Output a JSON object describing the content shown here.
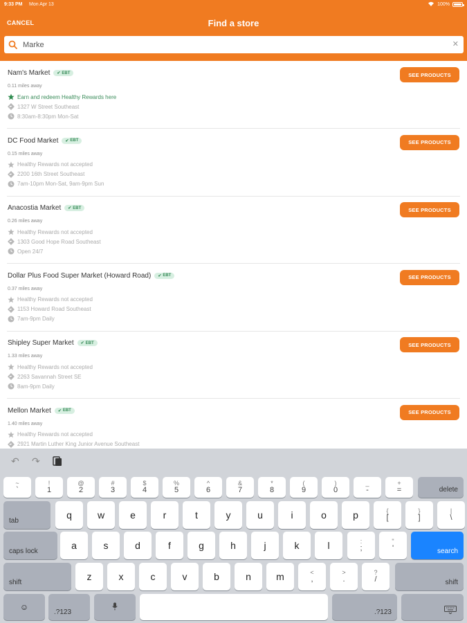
{
  "status": {
    "time": "9:33 PM",
    "date": "Mon Apr 13",
    "battery": "100%"
  },
  "header": {
    "cancel_label": "CANCEL",
    "title": "Find a store"
  },
  "search": {
    "value": "Marke",
    "placeholder": ""
  },
  "see_products_label": "SEE PRODUCTS",
  "ebt_label": "EBT",
  "stores": [
    {
      "name": "Nam's Market",
      "distance": "0.11 miles away",
      "rewards": "Earn and redeem Healthy Rewards here",
      "rewards_accepted": true,
      "address": "1327 W Street Southeast",
      "hours": "8:30am-8:30pm Mon-Sat"
    },
    {
      "name": "DC Food Market",
      "distance": "0.15 miles away",
      "rewards": "Healthy Rewards not accepted",
      "rewards_accepted": false,
      "address": "2200 16th Street Southeast",
      "hours": "7am-10pm Mon-Sat, 9am-9pm Sun"
    },
    {
      "name": "Anacostia Market",
      "distance": "0.26 miles away",
      "rewards": "Healthy Rewards not accepted",
      "rewards_accepted": false,
      "address": "1303 Good Hope Road Southeast",
      "hours": "Open 24/7"
    },
    {
      "name": "Dollar Plus Food Super Market (Howard Road)",
      "distance": "0.37 miles away",
      "rewards": "Healthy Rewards not accepted",
      "rewards_accepted": false,
      "address": "1153 Howard Road Southeast",
      "hours": "7am-9pm Daily"
    },
    {
      "name": "Shipley Super Market",
      "distance": "1.33 miles away",
      "rewards": "Healthy Rewards not accepted",
      "rewards_accepted": false,
      "address": "2263 Savannah Street SE",
      "hours": "8am-9pm Daily"
    },
    {
      "name": "Mellon Market",
      "distance": "1.40 miles away",
      "rewards": "Healthy Rewards not accepted",
      "rewards_accepted": false,
      "address": "2921 Martin Luther King Junior Avenue Southeast",
      "hours": ""
    }
  ],
  "keyboard": {
    "row1": [
      {
        "top": "~",
        "bot": "`"
      },
      {
        "top": "!",
        "bot": "1"
      },
      {
        "top": "@",
        "bot": "2"
      },
      {
        "top": "#",
        "bot": "3"
      },
      {
        "top": "$",
        "bot": "4"
      },
      {
        "top": "%",
        "bot": "5"
      },
      {
        "top": "^",
        "bot": "6"
      },
      {
        "top": "&",
        "bot": "7"
      },
      {
        "top": "*",
        "bot": "8"
      },
      {
        "top": "(",
        "bot": "9"
      },
      {
        "top": ")",
        "bot": "0"
      },
      {
        "top": "_",
        "bot": "-"
      },
      {
        "top": "+",
        "bot": "="
      }
    ],
    "delete_label": "delete",
    "tab_label": "tab",
    "row2": [
      "q",
      "w",
      "e",
      "r",
      "t",
      "y",
      "u",
      "i",
      "o",
      "p"
    ],
    "row2_sym": [
      {
        "top": "{",
        "bot": "["
      },
      {
        "top": "}",
        "bot": "]"
      },
      {
        "top": "|",
        "bot": "\\"
      }
    ],
    "caps_label": "caps lock",
    "row3": [
      "a",
      "s",
      "d",
      "f",
      "g",
      "h",
      "j",
      "k",
      "l"
    ],
    "row3_sym": [
      {
        "top": ":",
        "bot": ";"
      },
      {
        "top": "\"",
        "bot": "'"
      }
    ],
    "search_label": "search",
    "shift_label": "shift",
    "row4": [
      "z",
      "x",
      "c",
      "v",
      "b",
      "n",
      "m"
    ],
    "row4_sym": [
      {
        "top": "<",
        "bot": ","
      },
      {
        "top": ">",
        "bot": "."
      },
      {
        "top": "?",
        "bot": "/"
      }
    ],
    "numbers_label": ".?123"
  },
  "colors": {
    "brand": "#f07b21",
    "ebt_bg": "#d7efe1",
    "ebt_text": "#3a8c5a",
    "search_key": "#1a84ff"
  }
}
